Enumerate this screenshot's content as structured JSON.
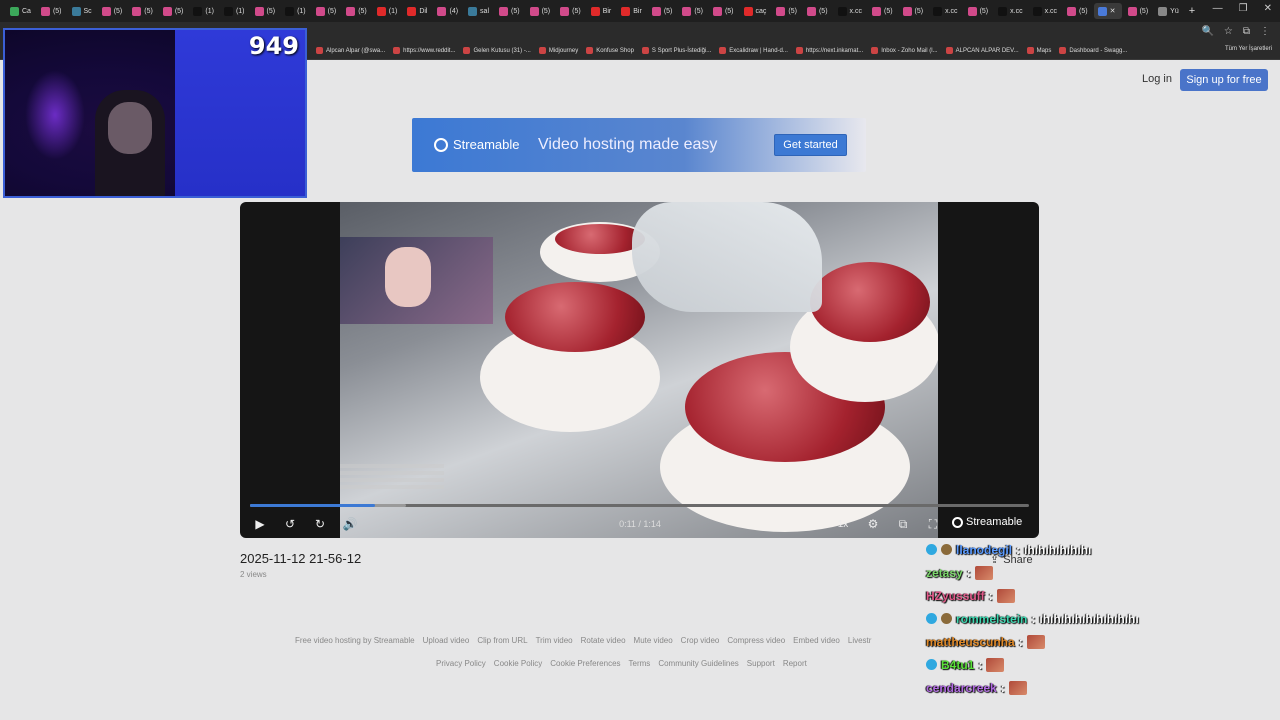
{
  "browser": {
    "tabs": [
      {
        "label": "Ca",
        "color": "#3ca85a"
      },
      {
        "label": "(5)",
        "color": "#d14a8a"
      },
      {
        "label": "Sc",
        "color": "#3a7a9a"
      },
      {
        "label": "(5)",
        "color": "#d14a8a"
      },
      {
        "label": "(5)",
        "color": "#d14a8a"
      },
      {
        "label": "(5)",
        "color": "#d14a8a"
      },
      {
        "label": "(1)",
        "color": "#111111"
      },
      {
        "label": "(1)",
        "color": "#111111"
      },
      {
        "label": "(5)",
        "color": "#d14a8a"
      },
      {
        "label": "(1)",
        "color": "#111111"
      },
      {
        "label": "(5)",
        "color": "#d14a8a"
      },
      {
        "label": "(5)",
        "color": "#d14a8a"
      },
      {
        "label": "(1)",
        "color": "#e02a2a"
      },
      {
        "label": "Dil",
        "color": "#e02a2a"
      },
      {
        "label": "(4)",
        "color": "#d14a8a"
      },
      {
        "label": "sal",
        "color": "#3a7a9a"
      },
      {
        "label": "(5)",
        "color": "#d14a8a"
      },
      {
        "label": "(5)",
        "color": "#d14a8a"
      },
      {
        "label": "(5)",
        "color": "#d14a8a"
      },
      {
        "label": "Bir",
        "color": "#e02a2a"
      },
      {
        "label": "Bir",
        "color": "#e02a2a"
      },
      {
        "label": "(5)",
        "color": "#d14a8a"
      },
      {
        "label": "(5)",
        "color": "#d14a8a"
      },
      {
        "label": "(5)",
        "color": "#d14a8a"
      },
      {
        "label": "caç",
        "color": "#e02a2a"
      },
      {
        "label": "(5)",
        "color": "#d14a8a"
      },
      {
        "label": "(5)",
        "color": "#d14a8a"
      },
      {
        "label": "x.cc",
        "color": "#111111"
      },
      {
        "label": "(5)",
        "color": "#d14a8a"
      },
      {
        "label": "(5)",
        "color": "#d14a8a"
      },
      {
        "label": "x.cc",
        "color": "#111111"
      },
      {
        "label": "(5)",
        "color": "#d14a8a"
      },
      {
        "label": "x.cc",
        "color": "#111111"
      },
      {
        "label": "x.cc",
        "color": "#111111"
      },
      {
        "label": "(5)",
        "color": "#d14a8a"
      }
    ],
    "active_tab_close": "✕",
    "extra_tabs": [
      {
        "label": "(5)",
        "color": "#d14a8a"
      },
      {
        "label": "Yü",
        "color": "#888888"
      }
    ],
    "new_tab": "+",
    "window_controls": [
      "—",
      "❐",
      "✕"
    ],
    "bookmarks": [
      "Alpcan Alpar (@swa...",
      "https://www.reddit...",
      "Gelen Kutusu (31) -...",
      "Midjourney",
      "Konfuse Shop",
      "S Sport Plus-İstediği...",
      "Excalidraw | Hand-d...",
      "https://next.inkarnat...",
      "Inbox - Zoho Mail (l...",
      "ALPCAN ALPAR DEV...",
      "Maps",
      "Dashboard - Swagg..."
    ],
    "all_bookmarks": "Tüm Yer İşaretleri"
  },
  "overlay": {
    "viewer_count": "949"
  },
  "header": {
    "login": "Log in",
    "signup": "Sign up for free"
  },
  "banner": {
    "logo_text": "Streamable",
    "tagline": "Video hosting made easy",
    "cta": "Get started"
  },
  "player": {
    "current_time": "0:11",
    "duration": "1:14",
    "time_display": "0:11 / 1:14",
    "speed": "1x",
    "brand": "Streamable",
    "progress_fraction": 0.16,
    "buffered_fraction": 0.2
  },
  "video": {
    "title": "2025-11-12 21-56-12",
    "views": "2 views",
    "share_label": "Share"
  },
  "footer": {
    "row1": [
      "Free video hosting by Streamable",
      "Upload video",
      "Clip from URL",
      "Trim video",
      "Rotate video",
      "Mute video",
      "Crop video",
      "Compress video",
      "Embed video",
      "Livestr"
    ],
    "row2": [
      "Privacy Policy",
      "Cookie Policy",
      "Cookie Preferences",
      "Terms",
      "Community Guidelines",
      "Support",
      "Report"
    ]
  },
  "chat": [
    {
      "user": "llanodegil",
      "color": "#5b9bff",
      "text": "ıhıhıhıhıhıhı",
      "emote": false,
      "badges": 2
    },
    {
      "user": "zetasy",
      "color": "#7bd66b",
      "text": "",
      "emote": true,
      "badges": 0
    },
    {
      "user": "HZyussuff",
      "color": "#e05a8a",
      "text": "",
      "emote": true,
      "badges": 0
    },
    {
      "user": "rommelstein",
      "color": "#3fd6b0",
      "text": "ıhıhıhıhıhıhıhıhıhı",
      "emote": false,
      "badges": 2
    },
    {
      "user": "mattheuscunha",
      "color": "#e08a2a",
      "text": "",
      "emote": true,
      "badges": 0
    },
    {
      "user": "B4tu1",
      "color": "#5ae03a",
      "text": "",
      "emote": true,
      "badges": 1
    },
    {
      "user": "cendarcreek",
      "color": "#b06ae0",
      "text": "",
      "emote": true,
      "badges": 0
    }
  ]
}
